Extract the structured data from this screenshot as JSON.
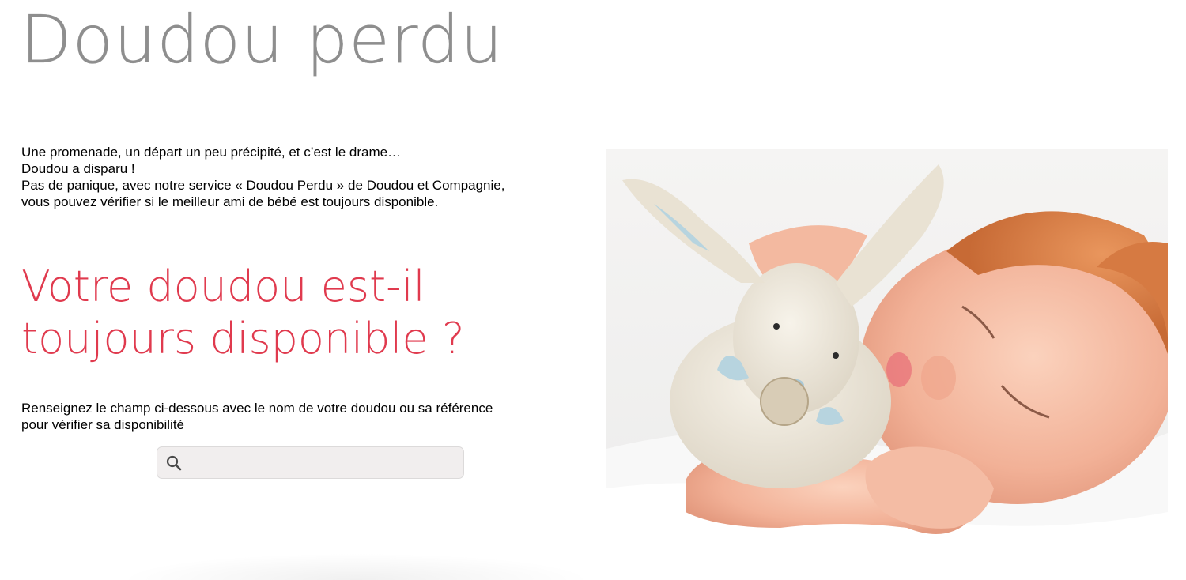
{
  "header": {
    "title": "Doudou perdu"
  },
  "intro": {
    "lines": [
      "Une promenade, un départ un peu précipité, et c’est le drame…",
      "Doudou a disparu !",
      "Pas de panique, avec notre service « Doudou Perdu » de Doudou et Compagnie,",
      "vous pouvez vérifier si le meilleur ami de bébé est toujours disponible."
    ]
  },
  "availability": {
    "heading_line1": "Votre doudou est-il",
    "heading_line2": "toujours disponible ?",
    "instructions_line1": "Renseignez le champ ci-dessous avec le nom de votre doudou ou sa référence",
    "instructions_line2": "pour vérifier sa disponibilité"
  },
  "search": {
    "value": "",
    "placeholder": "",
    "icon": "search-icon"
  },
  "colors": {
    "title_gray": "#8e8e8e",
    "heading_red": "#e03a4e",
    "search_bg": "#f1eeee"
  }
}
